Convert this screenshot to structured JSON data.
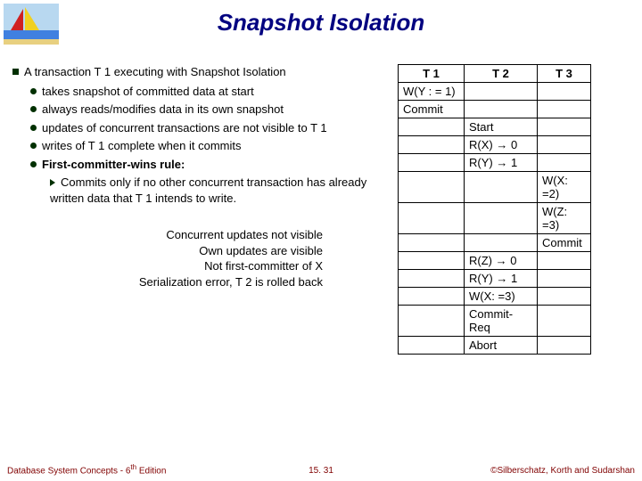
{
  "title": "Snapshot Isolation",
  "main": {
    "intro": "A transaction T 1 executing with Snapshot Isolation",
    "items": [
      "takes snapshot of committed data at start",
      "always reads/modifies data in its own snapshot",
      "updates of concurrent transactions are not visible to T 1",
      "writes of T 1 complete when it commits",
      "First-committer-wins rule:"
    ],
    "rule_detail": "Commits only if no other concurrent transaction has already written data that T 1 intends to write."
  },
  "notes": [
    "Concurrent updates not visible",
    "Own updates are visible",
    "Not first-committer of X",
    "Serialization error, T 2 is rolled back"
  ],
  "table": {
    "headers": [
      "T 1",
      "T 2",
      "T 3"
    ],
    "rows": [
      [
        "W(Y : = 1)",
        "",
        ""
      ],
      [
        "Commit",
        "",
        ""
      ],
      [
        "",
        "Start",
        ""
      ],
      [
        "",
        "R(X) → 0",
        ""
      ],
      [
        "",
        "R(Y) → 1",
        ""
      ],
      [
        "",
        "",
        "W(X: =2)"
      ],
      [
        "",
        "",
        "W(Z: =3)"
      ],
      [
        "",
        "",
        "Commit"
      ],
      [
        "",
        "R(Z) → 0",
        ""
      ],
      [
        "",
        "R(Y) → 1",
        ""
      ],
      [
        "",
        "W(X: =3)",
        ""
      ],
      [
        "",
        "Commit-Req",
        ""
      ],
      [
        "",
        "Abort",
        ""
      ]
    ]
  },
  "footer": {
    "left_a": "Database System Concepts - 6",
    "left_b": " Edition",
    "sup": "th",
    "center": "15. 31",
    "right": "©Silberschatz, Korth and Sudarshan"
  }
}
